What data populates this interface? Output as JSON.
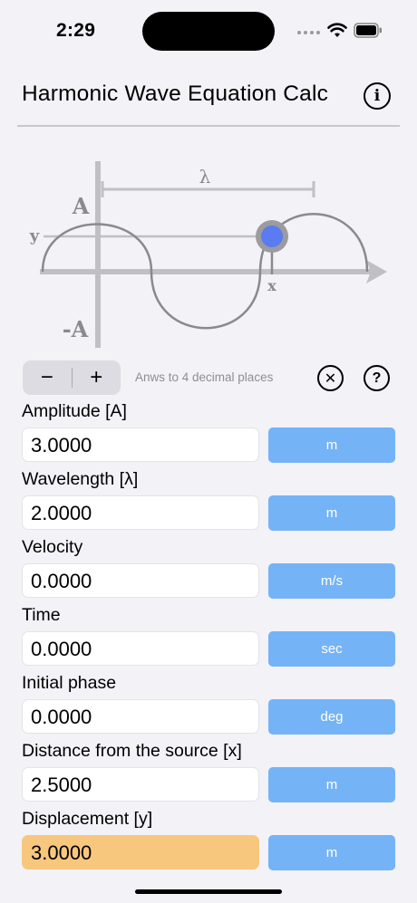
{
  "status_bar": {
    "time": "2:29"
  },
  "header": {
    "title": "Harmonic Wave Equation Calc"
  },
  "diagram": {
    "lambda": "λ",
    "amp_pos": "A",
    "amp_neg": "-A",
    "y": "y",
    "x": "x"
  },
  "controls": {
    "minus": "−",
    "plus": "+",
    "hint": "Anws to 4 decimal places",
    "clear": "✕",
    "help": "?"
  },
  "info_glyph": "i",
  "fields": [
    {
      "label": "Amplitude [A]",
      "value": "3.0000",
      "unit": "m"
    },
    {
      "label": "Wavelength [λ]",
      "value": "2.0000",
      "unit": "m"
    },
    {
      "label": "Velocity",
      "value": "0.0000",
      "unit": "m/s"
    },
    {
      "label": "Time",
      "value": "0.0000",
      "unit": "sec"
    },
    {
      "label": "Initial phase",
      "value": "0.0000",
      "unit": "deg"
    },
    {
      "label": "Distance from the source [x]",
      "value": "2.5000",
      "unit": "m"
    },
    {
      "label": "Displacement [y]",
      "value": "3.0000",
      "unit": "m"
    }
  ],
  "colors": {
    "result_field": "#f8c77e",
    "unit_button": "#75b3f7",
    "point": "#5b7cf0"
  }
}
